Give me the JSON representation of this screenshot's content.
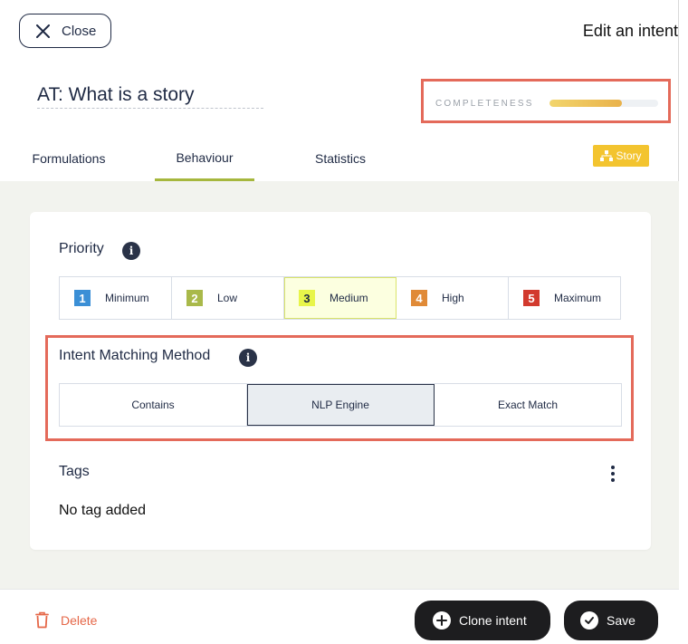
{
  "header": {
    "close_label": "Close",
    "panel_title": "Edit an intent"
  },
  "intent": {
    "name": "AT: What is a story",
    "completeness_label": "COMPLETENESS",
    "completeness_fraction": 0.67
  },
  "tabs": [
    {
      "label": "Formulations",
      "active": false
    },
    {
      "label": "Behaviour",
      "active": true
    },
    {
      "label": "Statistics",
      "active": false
    }
  ],
  "story_badge": {
    "label": "Story",
    "color": "#f3c42f"
  },
  "priority": {
    "title": "Priority",
    "options": [
      {
        "number": "1",
        "label": "Minimum",
        "color": "#3b8fd6",
        "selected": false
      },
      {
        "number": "2",
        "label": "Low",
        "color": "#a9b94a",
        "selected": false
      },
      {
        "number": "3",
        "label": "Medium",
        "color": "#e8f54a",
        "selected": true
      },
      {
        "number": "4",
        "label": "High",
        "color": "#e08a37",
        "selected": false
      },
      {
        "number": "5",
        "label": "Maximum",
        "color": "#d23a2e",
        "selected": false
      }
    ]
  },
  "matching": {
    "title": "Intent Matching Method",
    "options": [
      {
        "label": "Contains",
        "selected": false
      },
      {
        "label": "NLP Engine",
        "selected": true
      },
      {
        "label": "Exact Match",
        "selected": false
      }
    ]
  },
  "tags": {
    "title": "Tags",
    "empty_text": "No tag added"
  },
  "footer": {
    "delete_label": "Delete",
    "clone_label": "Clone intent",
    "save_label": "Save"
  },
  "colors": {
    "accent_tab": "#a6b73d",
    "highlight": "#e46a5a",
    "danger": "#e56748"
  }
}
